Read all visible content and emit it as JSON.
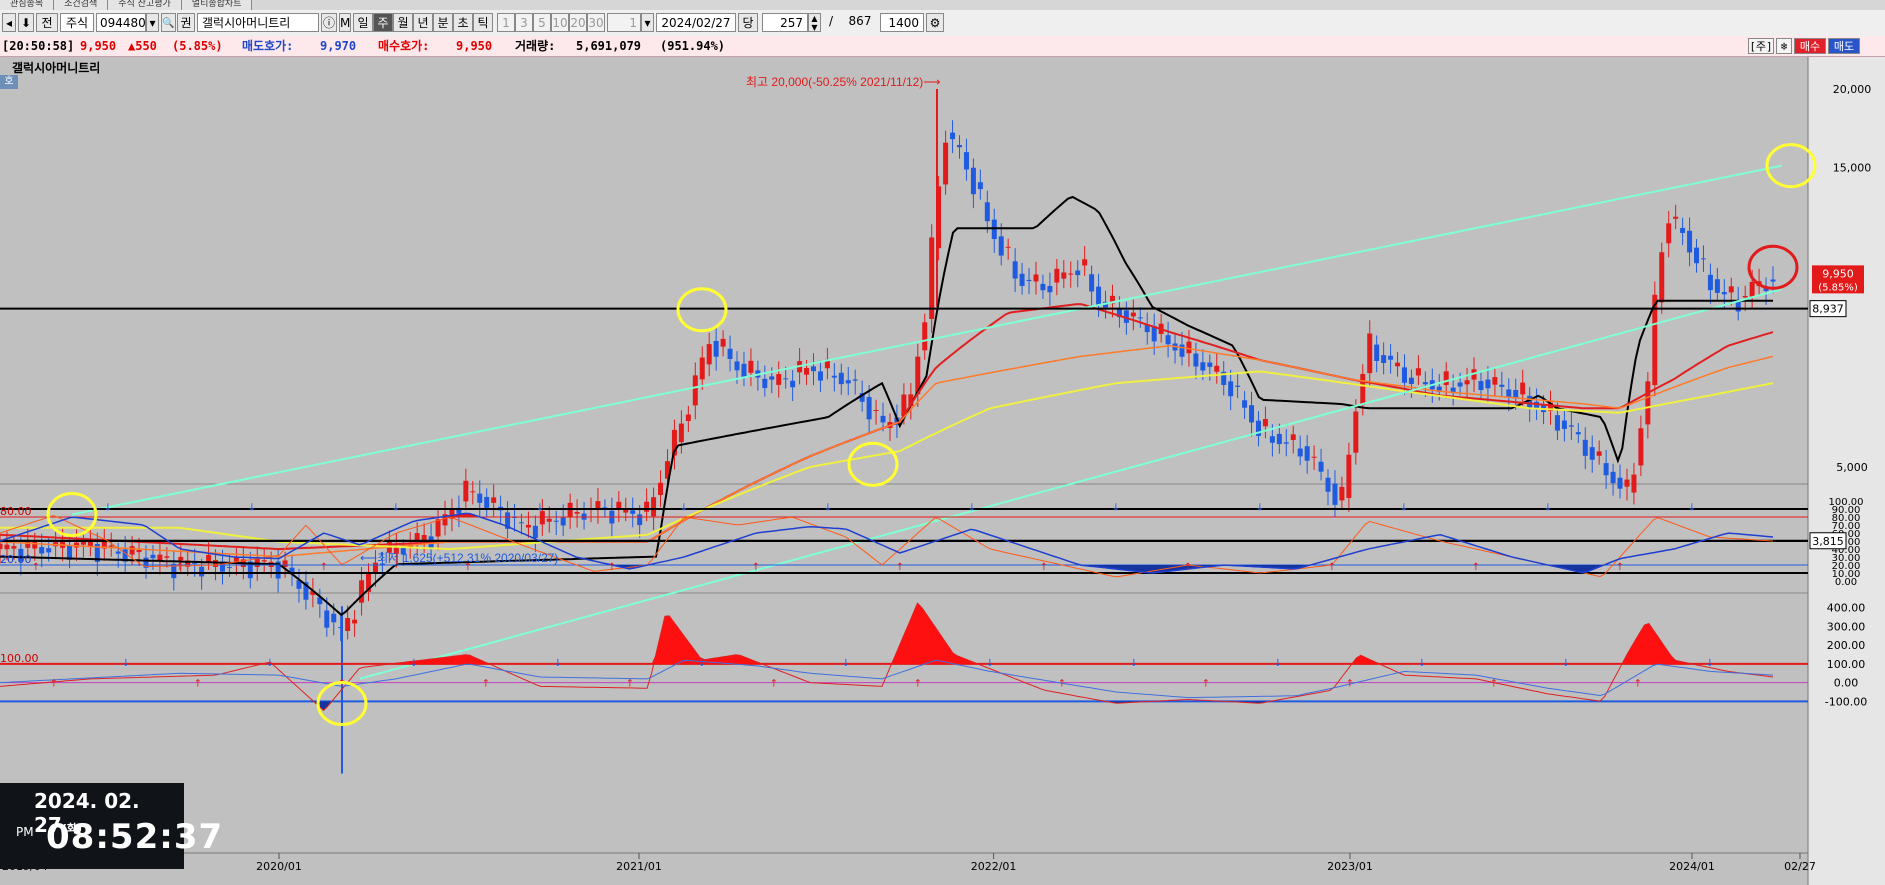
{
  "tabs": [
    "관심종목",
    "조건검색",
    "주식 잔고평가",
    "멀티종합차트"
  ],
  "toolbar": {
    "market": "주식",
    "code": "094480",
    "search_icon": "🔍",
    "search_label": "권",
    "stock_name": "갤럭시아머니트리",
    "periods": [
      "일",
      "주",
      "월",
      "년",
      "분",
      "초",
      "틱"
    ],
    "active_period": "주",
    "intervals": [
      "1",
      "3",
      "5",
      "10",
      "20",
      "30"
    ],
    "interval_value": "1",
    "date": "2024/02/27",
    "display_count": "257",
    "slash": "/",
    "total_count": "867",
    "zoom": "1400"
  },
  "quote": {
    "time": "[20:50:58]",
    "price": "9,950",
    "change": "▲550",
    "change_pct": "(5.85%)",
    "ask_label": "매도호가:",
    "ask": "9,970",
    "bid_label": "매수호가:",
    "bid": "9,950",
    "volume_label": "거래량:",
    "volume": "5,691,079",
    "volume_pct": "(951.94%)",
    "btn_stock": "[주]",
    "btn_buy": "매수",
    "btn_sell": "매도"
  },
  "chart": {
    "stock_label": "갤럭시아머니트리",
    "hoga_badge": "호",
    "annotation_high": "최고 20,000(-50.25% 2021/11/12)⟶",
    "annotation_low": "⟵최저 1,625(+512.31% 2020/03/27)",
    "price_badge": "9,950",
    "price_badge_pct": "(5.85%)",
    "level_upper_badge": "8,937",
    "level_lower_badge": "3,815",
    "stoch_level_high": "80.00",
    "stoch_level_low": "20.00",
    "cci_level_high": "100.00"
  },
  "chart_data": {
    "type": "candlestick",
    "price_axis_ticks": [
      "20,000",
      "15,000",
      "5,000"
    ],
    "stoch_axis_ticks": [
      "100.00",
      "90.00",
      "80.00",
      "70.00",
      "60.00",
      "50.00",
      "40.00",
      "30.00",
      "20.00",
      "10.00",
      "0.00"
    ],
    "cci_axis_ticks": [
      "400.00",
      "300.00",
      "200.00",
      "100.00",
      "0.00",
      "-100.00"
    ],
    "x_ticks": [
      "2019/04",
      "2020/01",
      "2021/01",
      "2022/01",
      "2023/01",
      "2024/01",
      "02/27"
    ],
    "x_tick_pos": [
      0.0,
      0.155,
      0.355,
      0.552,
      0.75,
      0.94,
      1.0
    ],
    "high": 20000,
    "low": 1625,
    "last": 9950,
    "levels": [
      8937,
      3815
    ],
    "price_key": [
      [
        0.0,
        3700
      ],
      [
        0.05,
        3750
      ],
      [
        0.1,
        3500
      ],
      [
        0.155,
        3500
      ],
      [
        0.19,
        2700
      ],
      [
        0.21,
        3600
      ],
      [
        0.24,
        3900
      ],
      [
        0.26,
        4600
      ],
      [
        0.29,
        4000
      ],
      [
        0.33,
        4300
      ],
      [
        0.36,
        4200
      ],
      [
        0.38,
        6000
      ],
      [
        0.395,
        8000
      ],
      [
        0.41,
        7200
      ],
      [
        0.43,
        6800
      ],
      [
        0.45,
        7200
      ],
      [
        0.47,
        6900
      ],
      [
        0.49,
        5800
      ],
      [
        0.505,
        6300
      ],
      [
        0.515,
        9000
      ],
      [
        0.525,
        17000
      ],
      [
        0.535,
        15500
      ],
      [
        0.55,
        12000
      ],
      [
        0.565,
        10000
      ],
      [
        0.58,
        9700
      ],
      [
        0.6,
        10500
      ],
      [
        0.61,
        9200
      ],
      [
        0.63,
        8600
      ],
      [
        0.655,
        7700
      ],
      [
        0.68,
        6900
      ],
      [
        0.7,
        5700
      ],
      [
        0.725,
        5300
      ],
      [
        0.745,
        4300
      ],
      [
        0.76,
        7800
      ],
      [
        0.78,
        7000
      ],
      [
        0.8,
        6700
      ],
      [
        0.82,
        6900
      ],
      [
        0.845,
        6500
      ],
      [
        0.87,
        5800
      ],
      [
        0.89,
        5000
      ],
      [
        0.905,
        4500
      ],
      [
        0.915,
        6500
      ],
      [
        0.925,
        12500
      ],
      [
        0.935,
        11800
      ],
      [
        0.945,
        10300
      ],
      [
        0.955,
        9500
      ],
      [
        0.965,
        9200
      ],
      [
        0.975,
        9700
      ],
      [
        0.985,
        9950
      ]
    ],
    "envelope_key": [
      [
        0.0,
        3600
      ],
      [
        0.155,
        3500
      ],
      [
        0.19,
        2900
      ],
      [
        0.22,
        3500
      ],
      [
        0.365,
        3600
      ],
      [
        0.375,
        5400
      ],
      [
        0.46,
        6000
      ],
      [
        0.49,
        6800
      ],
      [
        0.5,
        5800
      ],
      [
        0.515,
        7000
      ],
      [
        0.53,
        12000
      ],
      [
        0.575,
        12000
      ],
      [
        0.595,
        13500
      ],
      [
        0.61,
        12800
      ],
      [
        0.625,
        10600
      ],
      [
        0.64,
        9000
      ],
      [
        0.66,
        8400
      ],
      [
        0.685,
        7800
      ],
      [
        0.7,
        6400
      ],
      [
        0.745,
        6300
      ],
      [
        0.76,
        6200
      ],
      [
        0.84,
        6200
      ],
      [
        0.855,
        6500
      ],
      [
        0.865,
        6200
      ],
      [
        0.89,
        6000
      ],
      [
        0.9,
        5000
      ],
      [
        0.91,
        7800
      ],
      [
        0.92,
        9200
      ],
      [
        0.985,
        9200
      ]
    ],
    "ma_slow_key": [
      [
        0.0,
        3900
      ],
      [
        0.155,
        3700
      ],
      [
        0.25,
        3800
      ],
      [
        0.36,
        3800
      ],
      [
        0.45,
        5200
      ],
      [
        0.5,
        5900
      ],
      [
        0.52,
        7200
      ],
      [
        0.56,
        8800
      ],
      [
        0.6,
        9100
      ],
      [
        0.65,
        8200
      ],
      [
        0.7,
        7400
      ],
      [
        0.75,
        6900
      ],
      [
        0.8,
        6500
      ],
      [
        0.88,
        6200
      ],
      [
        0.9,
        6200
      ],
      [
        0.93,
        6900
      ],
      [
        0.96,
        7800
      ],
      [
        0.985,
        8200
      ]
    ],
    "ma_mid_key": [
      [
        0.0,
        3800
      ],
      [
        0.155,
        3600
      ],
      [
        0.25,
        3800
      ],
      [
        0.36,
        3800
      ],
      [
        0.45,
        5200
      ],
      [
        0.5,
        5900
      ],
      [
        0.52,
        6800
      ],
      [
        0.6,
        7500
      ],
      [
        0.65,
        7800
      ],
      [
        0.7,
        7400
      ],
      [
        0.75,
        6900
      ],
      [
        0.8,
        6600
      ],
      [
        0.88,
        6300
      ],
      [
        0.9,
        6200
      ],
      [
        0.93,
        6700
      ],
      [
        0.96,
        7200
      ],
      [
        0.985,
        7500
      ]
    ],
    "ma_long_key": [
      [
        0.0,
        4000
      ],
      [
        0.1,
        4000
      ],
      [
        0.155,
        3800
      ],
      [
        0.25,
        3700
      ],
      [
        0.36,
        3900
      ],
      [
        0.45,
        5000
      ],
      [
        0.5,
        5300
      ],
      [
        0.55,
        6200
      ],
      [
        0.62,
        6800
      ],
      [
        0.7,
        7100
      ],
      [
        0.78,
        6600
      ],
      [
        0.85,
        6200
      ],
      [
        0.9,
        6100
      ],
      [
        0.95,
        6500
      ],
      [
        0.985,
        6800
      ]
    ],
    "trend_upper": [
      [
        0.04,
        4200
      ],
      [
        0.99,
        15100
      ]
    ],
    "trend_lower": [
      [
        0.2,
        2300
      ],
      [
        0.99,
        9600
      ]
    ],
    "stoch_blue_key": [
      [
        0.0,
        50
      ],
      [
        0.04,
        80
      ],
      [
        0.08,
        70
      ],
      [
        0.1,
        40
      ],
      [
        0.13,
        30
      ],
      [
        0.155,
        28
      ],
      [
        0.18,
        60
      ],
      [
        0.2,
        45
      ],
      [
        0.23,
        75
      ],
      [
        0.26,
        85
      ],
      [
        0.28,
        70
      ],
      [
        0.32,
        30
      ],
      [
        0.35,
        15
      ],
      [
        0.38,
        30
      ],
      [
        0.42,
        60
      ],
      [
        0.45,
        68
      ],
      [
        0.47,
        65
      ],
      [
        0.5,
        35
      ],
      [
        0.54,
        65
      ],
      [
        0.56,
        50
      ],
      [
        0.6,
        20
      ],
      [
        0.64,
        10
      ],
      [
        0.68,
        20
      ],
      [
        0.72,
        15
      ],
      [
        0.76,
        40
      ],
      [
        0.8,
        58
      ],
      [
        0.84,
        30
      ],
      [
        0.88,
        10
      ],
      [
        0.9,
        28
      ],
      [
        0.93,
        40
      ],
      [
        0.96,
        60
      ],
      [
        0.985,
        55
      ]
    ],
    "stoch_red_key": [
      [
        0.0,
        60
      ],
      [
        0.03,
        82
      ],
      [
        0.06,
        50
      ],
      [
        0.08,
        18
      ],
      [
        0.12,
        20
      ],
      [
        0.155,
        32
      ],
      [
        0.17,
        70
      ],
      [
        0.19,
        20
      ],
      [
        0.22,
        60
      ],
      [
        0.25,
        80
      ],
      [
        0.29,
        45
      ],
      [
        0.33,
        12
      ],
      [
        0.36,
        20
      ],
      [
        0.38,
        80
      ],
      [
        0.41,
        70
      ],
      [
        0.44,
        80
      ],
      [
        0.47,
        55
      ],
      [
        0.49,
        20
      ],
      [
        0.52,
        80
      ],
      [
        0.55,
        40
      ],
      [
        0.58,
        25
      ],
      [
        0.62,
        5
      ],
      [
        0.66,
        20
      ],
      [
        0.7,
        10
      ],
      [
        0.74,
        20
      ],
      [
        0.76,
        75
      ],
      [
        0.8,
        50
      ],
      [
        0.85,
        25
      ],
      [
        0.89,
        5
      ],
      [
        0.92,
        80
      ],
      [
        0.95,
        55
      ],
      [
        0.985,
        50
      ]
    ],
    "cci_blue_key": [
      [
        0.0,
        0
      ],
      [
        0.1,
        50
      ],
      [
        0.155,
        40
      ],
      [
        0.19,
        -20
      ],
      [
        0.22,
        20
      ],
      [
        0.26,
        100
      ],
      [
        0.3,
        30
      ],
      [
        0.36,
        20
      ],
      [
        0.38,
        120
      ],
      [
        0.42,
        90
      ],
      [
        0.45,
        50
      ],
      [
        0.49,
        20
      ],
      [
        0.52,
        120
      ],
      [
        0.55,
        60
      ],
      [
        0.62,
        -50
      ],
      [
        0.66,
        -80
      ],
      [
        0.72,
        -70
      ],
      [
        0.74,
        -30
      ],
      [
        0.78,
        60
      ],
      [
        0.82,
        40
      ],
      [
        0.86,
        -30
      ],
      [
        0.89,
        -70
      ],
      [
        0.92,
        100
      ],
      [
        0.95,
        60
      ],
      [
        0.985,
        40
      ]
    ],
    "cci_red_key": [
      [
        0.0,
        -20
      ],
      [
        0.05,
        20
      ],
      [
        0.12,
        40
      ],
      [
        0.15,
        110
      ],
      [
        0.18,
        -150
      ],
      [
        0.2,
        80
      ],
      [
        0.26,
        150
      ],
      [
        0.3,
        -20
      ],
      [
        0.36,
        -30
      ],
      [
        0.37,
        380
      ],
      [
        0.39,
        120
      ],
      [
        0.41,
        150
      ],
      [
        0.45,
        0
      ],
      [
        0.49,
        -20
      ],
      [
        0.51,
        430
      ],
      [
        0.53,
        150
      ],
      [
        0.58,
        -40
      ],
      [
        0.62,
        -110
      ],
      [
        0.66,
        -90
      ],
      [
        0.7,
        -110
      ],
      [
        0.74,
        -40
      ],
      [
        0.755,
        150
      ],
      [
        0.78,
        40
      ],
      [
        0.82,
        20
      ],
      [
        0.86,
        -60
      ],
      [
        0.89,
        -100
      ],
      [
        0.905,
        170
      ],
      [
        0.915,
        330
      ],
      [
        0.93,
        120
      ],
      [
        0.96,
        60
      ],
      [
        0.985,
        30
      ]
    ]
  }
}
